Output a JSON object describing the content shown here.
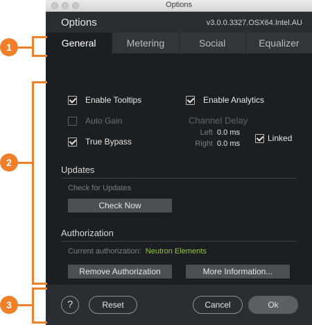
{
  "window": {
    "title": "Options"
  },
  "header": {
    "title": "Options",
    "version": "v3.0.0.3327.OSX64.Intel.AU"
  },
  "tabs": [
    {
      "label": "General"
    },
    {
      "label": "Metering"
    },
    {
      "label": "Social"
    },
    {
      "label": "Equalizer"
    }
  ],
  "general": {
    "enable_tooltips": {
      "label": "Enable Tooltips",
      "checked": true
    },
    "enable_analytics": {
      "label": "Enable Analytics",
      "checked": true
    },
    "auto_gain": {
      "label": "Auto Gain",
      "checked": false,
      "disabled": true
    },
    "true_bypass": {
      "label": "True Bypass",
      "checked": true
    },
    "channel_delay": {
      "title": "Channel Delay",
      "left_label": "Left",
      "left_value": "0.0 ms",
      "right_label": "Right",
      "right_value": "0.0 ms",
      "linked_label": "Linked",
      "linked": true
    }
  },
  "updates": {
    "title": "Updates",
    "check_label": "Check for Updates",
    "check_button": "Check Now"
  },
  "authorization": {
    "title": "Authorization",
    "current_label": "Current authorization:",
    "current_value": "Neutron Elements",
    "remove_button": "Remove Authorization",
    "more_button": "More Information..."
  },
  "footer": {
    "help_symbol": "?",
    "reset": "Reset",
    "cancel": "Cancel",
    "ok": "Ok"
  },
  "callouts": [
    "1",
    "2",
    "3"
  ],
  "colors": {
    "accent": "#f07f2a",
    "auth_value": "#9ac23c"
  }
}
